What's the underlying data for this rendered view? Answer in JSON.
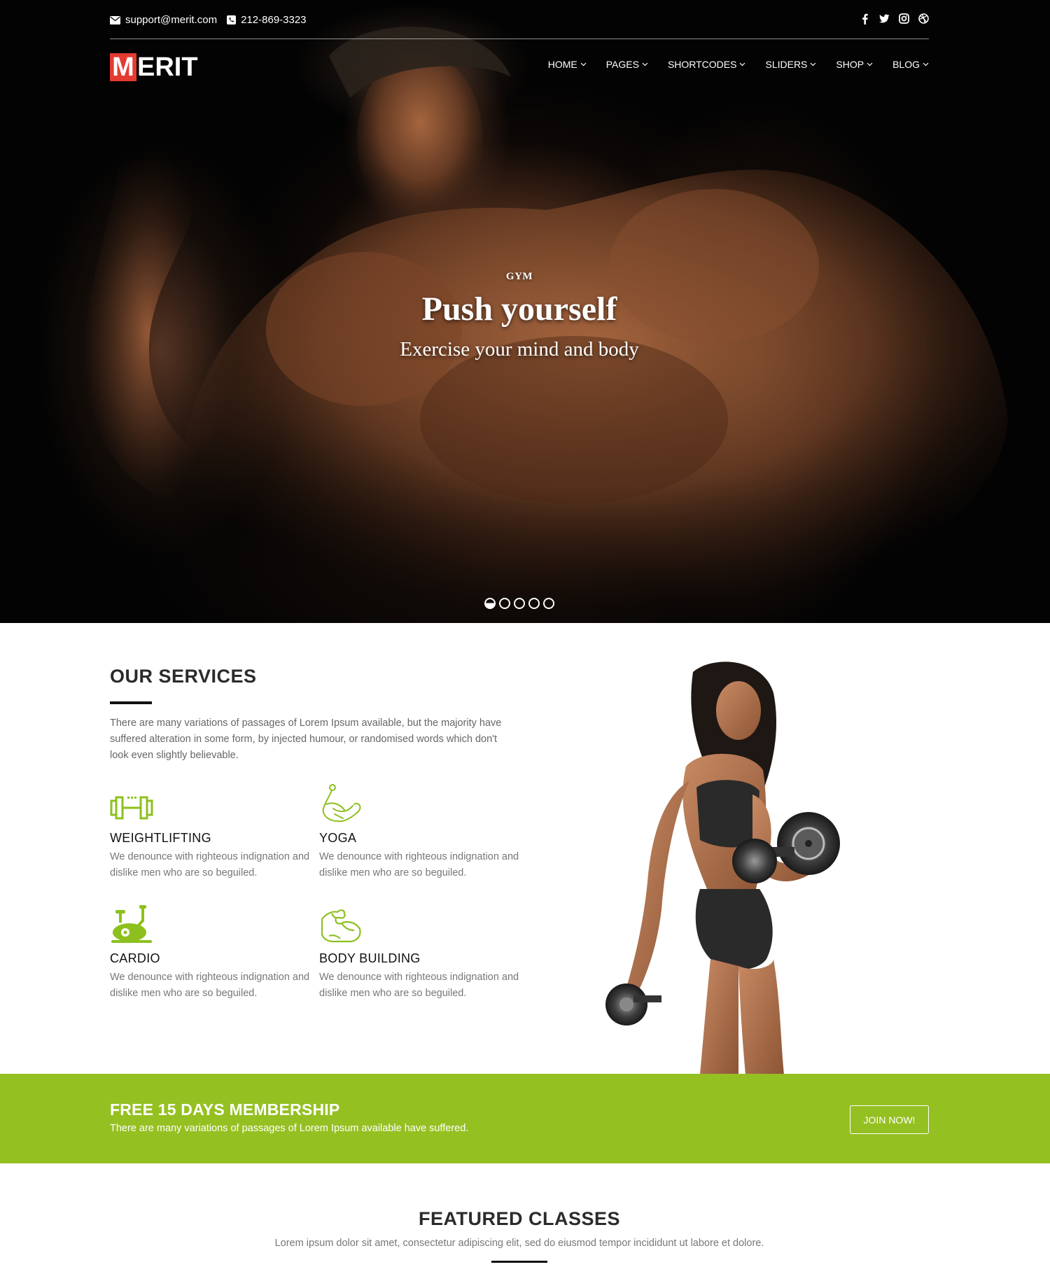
{
  "topbar": {
    "email": "support@merit.com",
    "phone": "212-869-3323",
    "social_icons": [
      "facebook-icon",
      "twitter-icon",
      "instagram-icon",
      "dribbble-icon"
    ]
  },
  "brand": {
    "logo_initial": "M",
    "logo_rest": "ERIT",
    "accent": "#e53a30"
  },
  "nav": {
    "items": [
      {
        "label": "HOME"
      },
      {
        "label": "PAGES"
      },
      {
        "label": "SHORTCODES"
      },
      {
        "label": "SLIDERS"
      },
      {
        "label": "SHOP"
      },
      {
        "label": "BLOG"
      }
    ]
  },
  "hero": {
    "eyebrow": "GYM",
    "title": "Push yourself",
    "subtitle": "Exercise your mind and body",
    "slides_count": 5,
    "active_slide": 1
  },
  "services": {
    "title": "OUR SERVICES",
    "intro": "There are many variations of passages of Lorem Ipsum available, but the majority have suffered alteration in some form, by injected humour, or randomised words which don't look even slightly believable.",
    "items": [
      {
        "title": "WEIGHTLIFTING",
        "text": "We denounce with righteous indignation and dislike men who are so beguiled.",
        "icon": "dumbbell-icon"
      },
      {
        "title": "YOGA",
        "text": "We denounce with righteous indignation and dislike men who are so beguiled.",
        "icon": "yoga-icon"
      },
      {
        "title": "CARDIO",
        "text": "We denounce with righteous indignation and dislike men who are so beguiled.",
        "icon": "exercise-bike-icon"
      },
      {
        "title": "BODY BUILDING",
        "text": "We denounce with righteous indignation and dislike men who are so beguiled.",
        "icon": "flexed-arm-icon"
      }
    ],
    "icon_color": "#8dc01e"
  },
  "cta": {
    "title": "FREE 15 DAYS MEMBERSHIP",
    "subtitle": "There are many variations of passages of Lorem Ipsum available have suffered.",
    "button": "JOIN NOW!",
    "background": "#95c022"
  },
  "featured": {
    "title": "FEATURED CLASSES",
    "subtitle": "Lorem ipsum dolor sit amet, consectetur adipiscing elit, sed do eiusmod tempor incididunt ut labore et dolore."
  }
}
